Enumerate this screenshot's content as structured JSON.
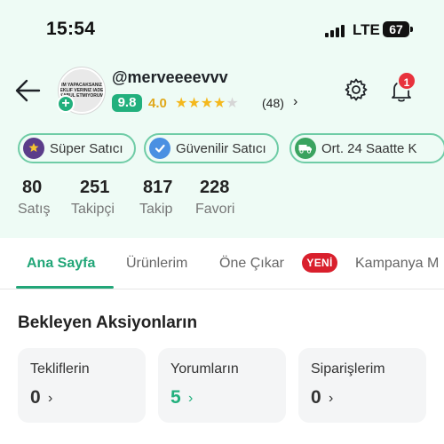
{
  "status_bar": {
    "time": "15:54",
    "network": "LTE",
    "battery": "67"
  },
  "profile": {
    "avatar_text": [
      "IM YAPACAKSANIZ",
      "EKLIF VERINIZ IADE",
      "KABUL ETMIYORUM"
    ],
    "avatar_plus": "+",
    "username": "@merveeeevvv",
    "score": "9.8",
    "rating": "4.0",
    "stars_filled": 4,
    "stars_total": 5,
    "review_count": "(48)",
    "review_chevron": "›",
    "notifications_count": "1"
  },
  "badges": [
    {
      "label": "Süper Satıcı",
      "icon": "star-trophy-icon",
      "icon_color": "#5b3d8a"
    },
    {
      "label": "Güvenilir Satıcı",
      "icon": "verified-check-icon",
      "icon_color": "#4a90e2"
    },
    {
      "label": "Ort. 24 Saatte K",
      "icon": "delivery-truck-icon",
      "icon_color": "#3aa35f"
    }
  ],
  "stats": [
    {
      "value": "80",
      "label": "Satış"
    },
    {
      "value": "251",
      "label": "Takipçi"
    },
    {
      "value": "817",
      "label": "Takip"
    },
    {
      "value": "228",
      "label": "Favori"
    }
  ],
  "tabs": [
    {
      "label": "Ana Sayfa",
      "active": true
    },
    {
      "label": "Ürünlerim",
      "active": false
    },
    {
      "label": "Öne Çıkar",
      "active": false,
      "badge": "YENİ"
    },
    {
      "label": "Kampanya M",
      "active": false
    }
  ],
  "section": {
    "title": "Bekleyen Aksiyonların"
  },
  "cards": [
    {
      "title": "Tekliflerin",
      "count": "0",
      "chevron": "›",
      "highlight": false
    },
    {
      "title": "Yorumların",
      "count": "5",
      "chevron": "›",
      "highlight": true
    },
    {
      "title": "Siparişlerim",
      "count": "0",
      "chevron": "›",
      "highlight": false
    }
  ],
  "colors": {
    "accent": "#22b07d",
    "header_bg": "#eefbf5",
    "badge_border": "#6fcca6",
    "alert": "#e8323c"
  }
}
